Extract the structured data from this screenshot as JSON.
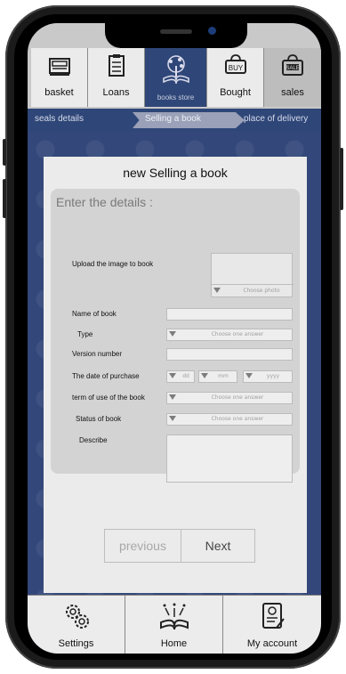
{
  "tabs": [
    {
      "label": "basket",
      "icon": "cash-register-icon"
    },
    {
      "label": "Loans",
      "icon": "loan-document-icon"
    },
    {
      "label": "books store",
      "icon": "book-tree-logo-icon"
    },
    {
      "label": "Bought",
      "icon": "buy-bag-icon"
    },
    {
      "label": "sales",
      "icon": "sale-bag-icon"
    }
  ],
  "breadcrumbs": [
    "seals  details",
    "Selling a book",
    "place of delivery"
  ],
  "form": {
    "title": "new Selling a book",
    "section_heading": "Enter the details :",
    "upload_label": "Upload the image to book",
    "choose_photo": "Choose photo",
    "name_label": "Name of book",
    "type_label": "Type",
    "type_placeholder": "Choose one answer",
    "version_label": "Version number",
    "date_label": "The date of purchase",
    "date_dd": "dd",
    "date_mm": "mm",
    "date_yyyy": "yyyy",
    "term_label": "term of use of the book",
    "term_placeholder": "Choose one answer",
    "status_label": "Status of book",
    "status_placeholder": "Choose one answer",
    "describe_label": "Describe"
  },
  "buttons": {
    "previous": "previous",
    "next": "Next"
  },
  "bottom_nav": [
    {
      "label": "Settings",
      "icon": "gears-icon"
    },
    {
      "label": "Home",
      "icon": "open-book-home-icon"
    },
    {
      "label": "My account",
      "icon": "account-document-icon"
    }
  ],
  "colors": {
    "brand": "#2f4778",
    "background": "#33477a",
    "card": "#ebebeb"
  }
}
